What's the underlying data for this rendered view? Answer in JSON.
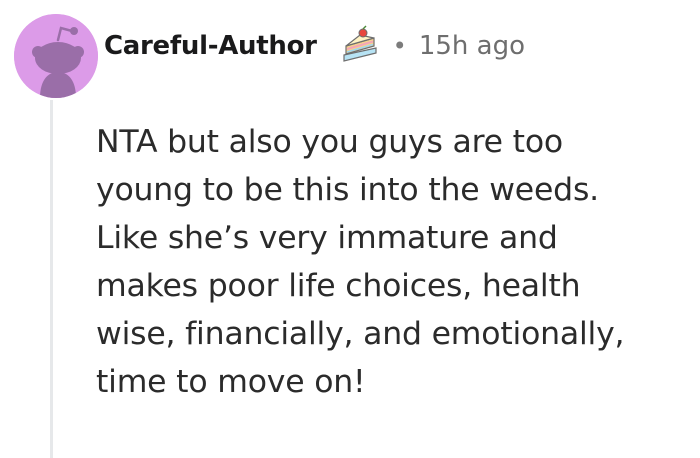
{
  "comment": {
    "author": "Careful-Author",
    "separator": "•",
    "timestamp": "15h ago",
    "flair_icon": "cake-icon",
    "avatar_icon": "snoo-avatar-icon",
    "body_lines": [
      "NTA but also you guys are too",
      "young to be this into the weeds.",
      "Like she’s very immature and",
      "makes poor life choices, health",
      "wise, financially, and emotionally,",
      "time to move on!"
    ]
  },
  "colors": {
    "avatar_bg": "#dc9be8",
    "avatar_figure": "#9a6ea8",
    "thread_line": "#e6e8ea",
    "text": "#2b2b2b",
    "meta": "#6e6e6e"
  }
}
